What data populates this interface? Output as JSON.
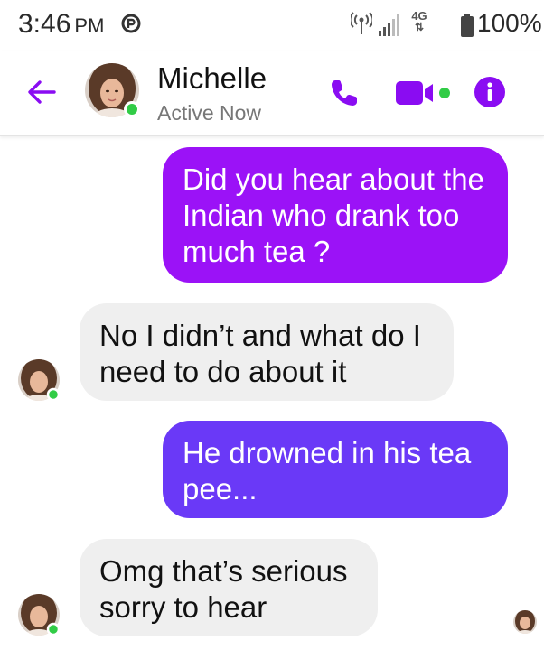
{
  "status_bar": {
    "time": "3:46",
    "ampm": "PM",
    "network": "4G",
    "battery": "100%"
  },
  "header": {
    "contact_name": "Michelle",
    "contact_status": "Active Now"
  },
  "messages": [
    {
      "direction": "outgoing",
      "text": "Did you hear about the Indian who drank too much tea ?"
    },
    {
      "direction": "incoming",
      "text": "No I didn’t and what do I need to do about it"
    },
    {
      "direction": "outgoing",
      "text": "He drowned in his tea pee..."
    },
    {
      "direction": "incoming",
      "text": "Omg that’s serious sorry to hear"
    }
  ],
  "colors": {
    "accent": "#8a0cf2",
    "bubble_out_1": "#9b12f7",
    "bubble_out_2": "#6a39f7",
    "bubble_in": "#efefef",
    "online": "#31cc46"
  },
  "icons": [
    "back-arrow-icon",
    "phone-icon",
    "video-camera-icon",
    "info-icon",
    "hotspot-icon",
    "signal-icon",
    "battery-icon",
    "messenger-notification-icon"
  ]
}
